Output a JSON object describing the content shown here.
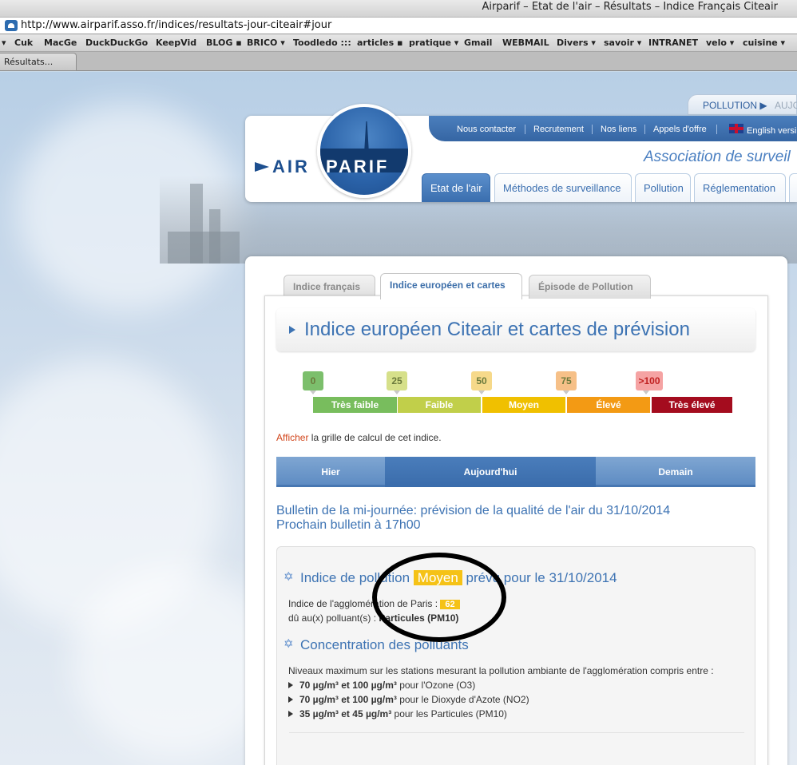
{
  "browser": {
    "window_title": "Airparif – Etat de l'air – Résultats – Indice Français Citeair",
    "url": "http://www.airparif.asso.fr/indices/resultats-jour-citeair#jour",
    "bookmarks": [
      "Cuk",
      "MacGe",
      "DuckDuckGo",
      "KeepVid",
      "BLOG ▪",
      "BRICO ▾",
      "Toodledo :::",
      "articles ▪",
      "pratique ▾",
      "Gmail",
      "WEBMAIL",
      "Divers ▾",
      "savoir ▾",
      "INTRANET",
      "velo ▾",
      "cuisine ▾"
    ],
    "tab_label": "Résultats..."
  },
  "header": {
    "logo_air": "AIR",
    "logo_parif": "PARIF",
    "pollution_label": "POLLUTION ▶",
    "pollution_next": "AUJC",
    "top_nav": [
      "Nous contacter",
      "Recrutement",
      "Nos liens",
      "Appels d'offre"
    ],
    "lang_label": "English versi",
    "tagline": "Association de surveil",
    "main_nav": [
      "Etat de l'air",
      "Méthodes de surveillance",
      "Pollution",
      "Réglementation"
    ]
  },
  "subtabs": [
    "Indice français",
    "Indice européen et cartes",
    "Épisode de Pollution"
  ],
  "page_title": "Indice européen Citeair et cartes de prévision",
  "scale": {
    "ticks": [
      "0",
      "25",
      "50",
      "75",
      ">100"
    ],
    "levels": [
      "Très faible",
      "Faible",
      "Moyen",
      "Élevé",
      "Très élevé"
    ],
    "tick_colors": [
      "#7cbf6c",
      "#d6e08a",
      "#f6d98a",
      "#f6c088",
      "#f5a3a3"
    ],
    "level_colors": [
      "#78bd5d",
      "#c1cf4a",
      "#f0c000",
      "#f39a14",
      "#a40c1e"
    ]
  },
  "afficher": {
    "link": "Afficher",
    "text": " la grille de calcul de cet indice."
  },
  "day_tabs": [
    "Hier",
    "Aujourd'hui",
    "Demain"
  ],
  "bulletin": {
    "line1": "Bulletin de la mi-journée: prévision de la qualité de l'air du 31/10/2014",
    "line2": "Prochain bulletin à 17h00"
  },
  "indice": {
    "heading_pre": "Indice de pollution ",
    "heading_level": "Moyen",
    "heading_post": " prévu pour le 31/10/2014",
    "agglo_label": "Indice de l'agglomération de Paris : ",
    "agglo_value": "62",
    "polluant_label": "dû au(x) polluant(s) : ",
    "polluant_value": "Particules (PM10)"
  },
  "concentration": {
    "heading": "Concentration des polluants",
    "intro": "Niveaux maximum sur les stations mesurant la pollution ambiante de l'agglomération compris entre :",
    "items": [
      {
        "range": "70 µg/m³ et 100 µg/m³",
        "rest": " pour l'Ozone (O3)"
      },
      {
        "range": "70 µg/m³ et 100 µg/m³",
        "rest": " pour le Dioxyde d'Azote (NO2)"
      },
      {
        "range": "35 µg/m³ et 45 µg/m³",
        "rest": " pour les Particules (PM10)"
      }
    ]
  }
}
